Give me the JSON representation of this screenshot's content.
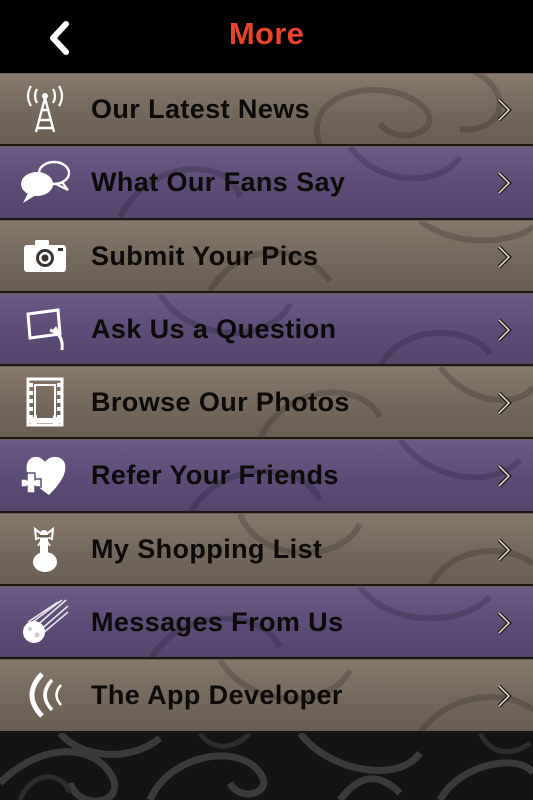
{
  "header": {
    "title": "More",
    "back_icon": "chevron-left-icon",
    "title_color": "#e8432b"
  },
  "menu": {
    "items": [
      {
        "label": "Our Latest News",
        "icon": "radio-tower-icon",
        "tone": "tan"
      },
      {
        "label": "What Our Fans Say",
        "icon": "speech-bubbles-icon",
        "tone": "purple"
      },
      {
        "label": "Submit Your Pics",
        "icon": "camera-icon",
        "tone": "tan"
      },
      {
        "label": "Ask Us a Question",
        "icon": "question-arrow-icon",
        "tone": "purple"
      },
      {
        "label": "Browse Our Photos",
        "icon": "film-strip-icon",
        "tone": "tan"
      },
      {
        "label": "Refer Your Friends",
        "icon": "heart-plus-icon",
        "tone": "purple"
      },
      {
        "label": "My Shopping List",
        "icon": "finger-bow-icon",
        "tone": "tan"
      },
      {
        "label": "Messages From Us",
        "icon": "comet-icon",
        "tone": "purple"
      },
      {
        "label": "The App Developer",
        "icon": "signal-waves-icon",
        "tone": "tan"
      }
    ],
    "chevron_icon": "chevron-right-icon"
  },
  "colors": {
    "tan_row": "#7a6d60",
    "purple_row": "#5f4e7a",
    "label_text": "#0d0b0a"
  }
}
